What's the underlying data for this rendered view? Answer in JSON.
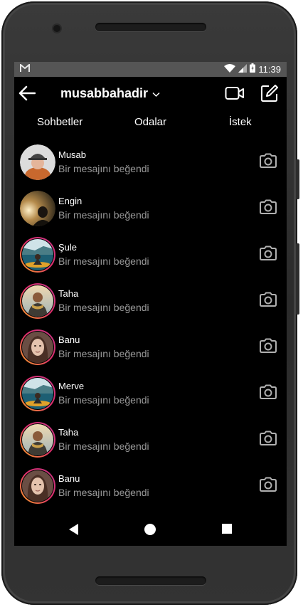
{
  "status": {
    "carrier_icon": "gmail-m-icon",
    "time": "11:39"
  },
  "header": {
    "username": "musabbahadir"
  },
  "tabs": [
    "Sohbetler",
    "Odalar",
    "İstek"
  ],
  "conversations": [
    {
      "name": "Musab",
      "preview": "Bir mesajını beğendi",
      "avatar": "hat-portrait",
      "story_ring": false
    },
    {
      "name": "Engin",
      "preview": "Bir mesajını beğendi",
      "avatar": "sunset-portrait",
      "story_ring": false
    },
    {
      "name": "Şule",
      "preview": "Bir mesajını beğendi",
      "avatar": "kayak-lake",
      "story_ring": true
    },
    {
      "name": "Taha",
      "preview": "Bir mesajını beğendi",
      "avatar": "scarf-portrait",
      "story_ring": true
    },
    {
      "name": "Banu",
      "preview": "Bir mesajını beğendi",
      "avatar": "woman-portrait",
      "story_ring": true
    },
    {
      "name": "Merve",
      "preview": "Bir mesajını beğendi",
      "avatar": "kayak-lake",
      "story_ring": true
    },
    {
      "name": "Taha",
      "preview": "Bir mesajını beğendi",
      "avatar": "scarf-portrait",
      "story_ring": true
    },
    {
      "name": "Banu",
      "preview": "Bir mesajını beğendi",
      "avatar": "woman-portrait",
      "story_ring": true
    }
  ],
  "colors": {
    "background": "#000000",
    "statusbar": "#555555",
    "secondary_text": "#9a9a9a",
    "ring_start": "#f5a623",
    "ring_end": "#c13584"
  }
}
